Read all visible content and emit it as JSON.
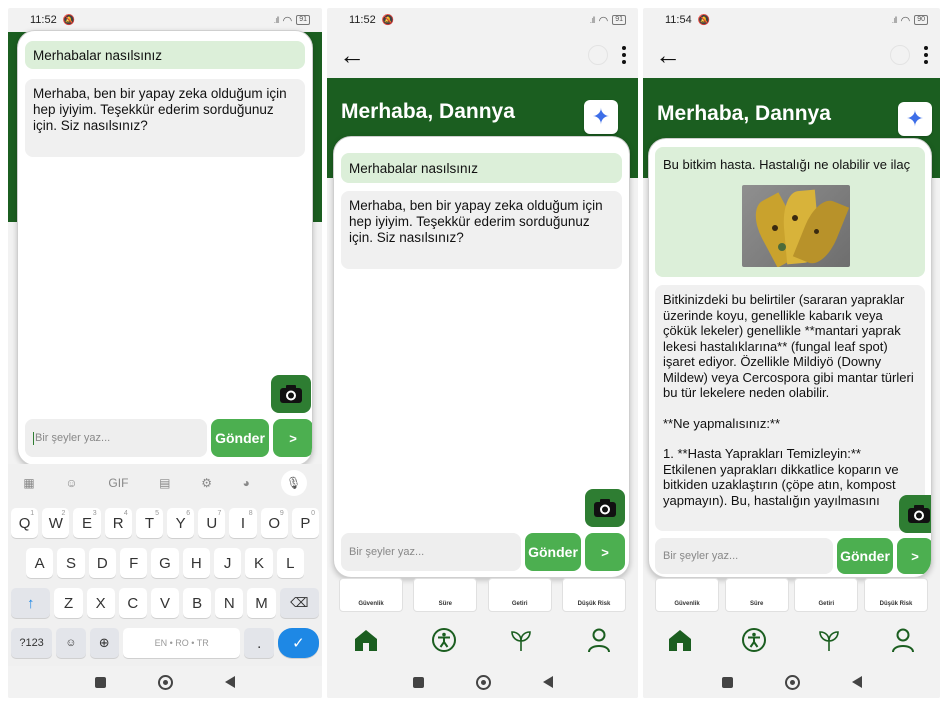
{
  "screens": [
    {
      "status": {
        "time": "11:52",
        "battery": "91"
      },
      "messages": {
        "user": "Merhabalar nasılsınız",
        "bot": "Merhaba, ben bir yapay zeka olduğum için hep iyiyim. Teşekkür ederim sorduğunuz için. Siz nasılsınız?"
      },
      "input_placeholder": "Bir şeyler yaz...",
      "send_label": "Gönder",
      "arrow_label": ">",
      "keyboard": {
        "row1": [
          [
            "Q",
            "1"
          ],
          [
            "W",
            "2"
          ],
          [
            "E",
            "3"
          ],
          [
            "R",
            "4"
          ],
          [
            "T",
            "5"
          ],
          [
            "Y",
            "6"
          ],
          [
            "U",
            "7"
          ],
          [
            "I",
            "8"
          ],
          [
            "O",
            "9"
          ],
          [
            "P",
            "0"
          ]
        ],
        "row2": [
          "A",
          "S",
          "D",
          "F",
          "G",
          "H",
          "J",
          "K",
          "L"
        ],
        "row3": [
          "Z",
          "X",
          "C",
          "V",
          "B",
          "N",
          "M"
        ],
        "sym_label": "?123",
        "lang_label": "EN • RO • TR",
        "period": ".",
        "gif": "GIF"
      }
    },
    {
      "status": {
        "time": "11:52",
        "battery": "91"
      },
      "greeting": "Merhaba, Dannya",
      "messages": {
        "user": "Merhabalar nasılsınız",
        "bot": "Merhaba, ben bir yapay zeka olduğum için hep iyiyim. Teşekkür ederim sorduğunuz için. Siz nasılsınız?"
      },
      "input_placeholder": "Bir şeyler yaz...",
      "send_label": "Gönder",
      "arrow_label": ">",
      "tiles": [
        "Güvenlik",
        "Süre",
        "Getiri",
        "Düşük Risk"
      ]
    },
    {
      "status": {
        "time": "11:54",
        "battery": "90"
      },
      "greeting": "Merhaba, Dannya",
      "messages": {
        "user": "Bu bitkim hasta. Hastalığı ne olabilir ve ilaç",
        "bot_paragraphs": [
          "Bitkinizdeki bu belirtiler (sararan yapraklar üzerinde koyu, genellikle kabarık veya çökük lekeler) genellikle **mantari yaprak lekesi hastalıklarına** (fungal leaf spot) işaret ediyor. Özellikle Mildiyö (Downy Mildew) veya Cercospora gibi mantar türleri bu tür lekelere neden olabilir.",
          "**Ne yapmalısınız:**",
          "1.  **Hasta Yaprakları Temizleyin:** Etkilenen yaprakları dikkatlice koparın ve bitkiden uzaklaştırın (çöpe atın, kompost yapmayın). Bu, hastalığın yayılmasını"
        ]
      },
      "input_placeholder": "Bir şeyler yaz...",
      "send_label": "Gönder",
      "arrow_label": ">",
      "tiles": [
        "Güvenlik",
        "Süre",
        "Getiri",
        "Düşük Risk"
      ]
    }
  ],
  "colors": {
    "dark_green": "#1b5e20",
    "button_green": "#4caf50",
    "user_bubble": "#dcefd9",
    "bot_bubble": "#f0f0f0",
    "ai_blue": "#3d6ee8"
  },
  "icons": {
    "nav": [
      "home-icon",
      "accessibility-icon",
      "sprout-icon",
      "person-icon"
    ],
    "chat": [
      "camera-icon",
      "sparkle-icon",
      "back-arrow-icon",
      "more-vert-icon"
    ]
  }
}
